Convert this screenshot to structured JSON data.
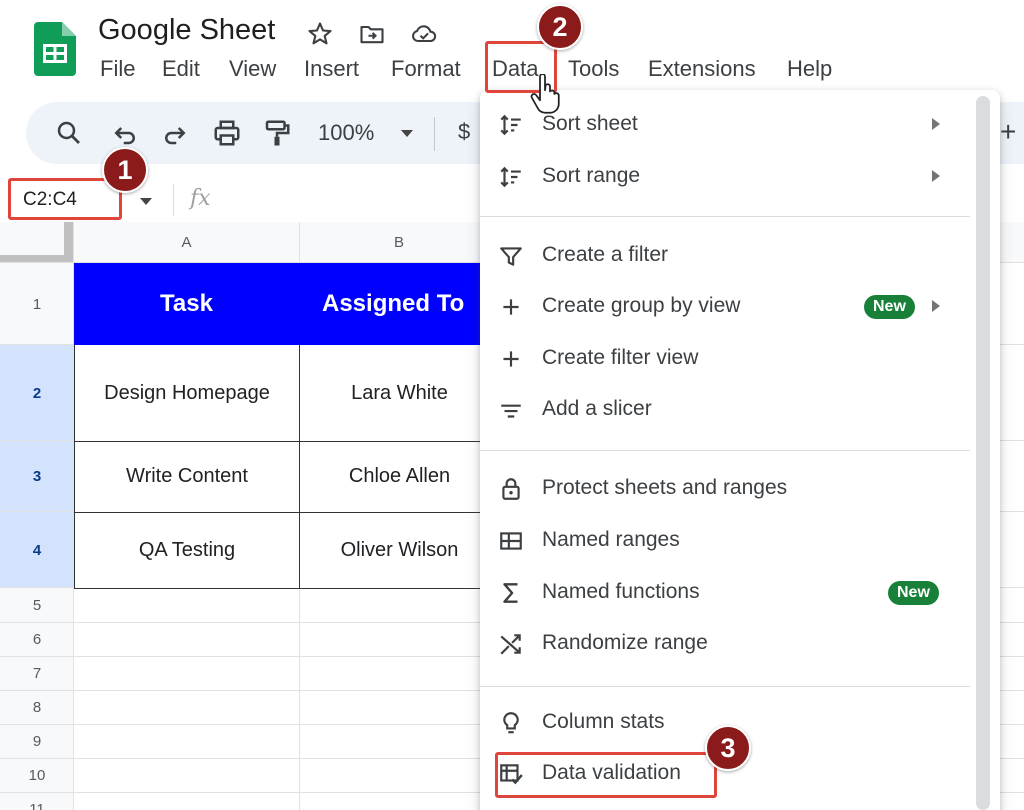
{
  "app": {
    "title": "Google Sheet",
    "menus": [
      "File",
      "Edit",
      "View",
      "Insert",
      "Format",
      "Data",
      "Tools",
      "Extensions",
      "Help"
    ]
  },
  "toolbar": {
    "zoom": "100%",
    "currency": "$",
    "plus": "+"
  },
  "formula_bar": {
    "name_box": "C2:C4",
    "fx": "fx"
  },
  "sheet": {
    "columns": [
      "A",
      "B"
    ],
    "rows": [
      "1",
      "2",
      "3",
      "4",
      "5",
      "6",
      "7",
      "8",
      "9",
      "10",
      "11"
    ],
    "header_row": [
      "Task",
      "Assigned To"
    ],
    "data_rows": [
      [
        "Design Homepage",
        "Lara White"
      ],
      [
        "Write Content",
        "Chloe Allen"
      ],
      [
        "QA Testing",
        "Oliver Wilson"
      ]
    ],
    "header_bg": "#0000ff",
    "selected_row_bg": "#d3e3fd"
  },
  "data_menu": {
    "items": [
      {
        "label": "Sort sheet",
        "icon": "sort-icon"
      },
      {
        "label": "Sort range",
        "icon": "sort-icon"
      },
      {
        "label": "Create a filter",
        "icon": "filter-icon"
      },
      {
        "label": "Create group by view",
        "icon": "plus-icon",
        "badge": "New"
      },
      {
        "label": "Create filter view",
        "icon": "plus-icon"
      },
      {
        "label": "Add a slicer",
        "icon": "slicer-icon"
      },
      {
        "label": "Protect sheets and ranges",
        "icon": "lock-icon"
      },
      {
        "label": "Named ranges",
        "icon": "named-ranges-icon"
      },
      {
        "label": "Named functions",
        "icon": "sigma-icon",
        "badge": "New"
      },
      {
        "label": "Randomize range",
        "icon": "shuffle-icon"
      },
      {
        "label": "Column stats",
        "icon": "lightbulb-icon"
      },
      {
        "label": "Data validation",
        "icon": "data-validation-icon"
      }
    ],
    "badge_color": "#188038"
  },
  "callouts": [
    "1",
    "2",
    "3"
  ],
  "callout_color": "#e0453b",
  "marker_color": "#8b1a1a"
}
